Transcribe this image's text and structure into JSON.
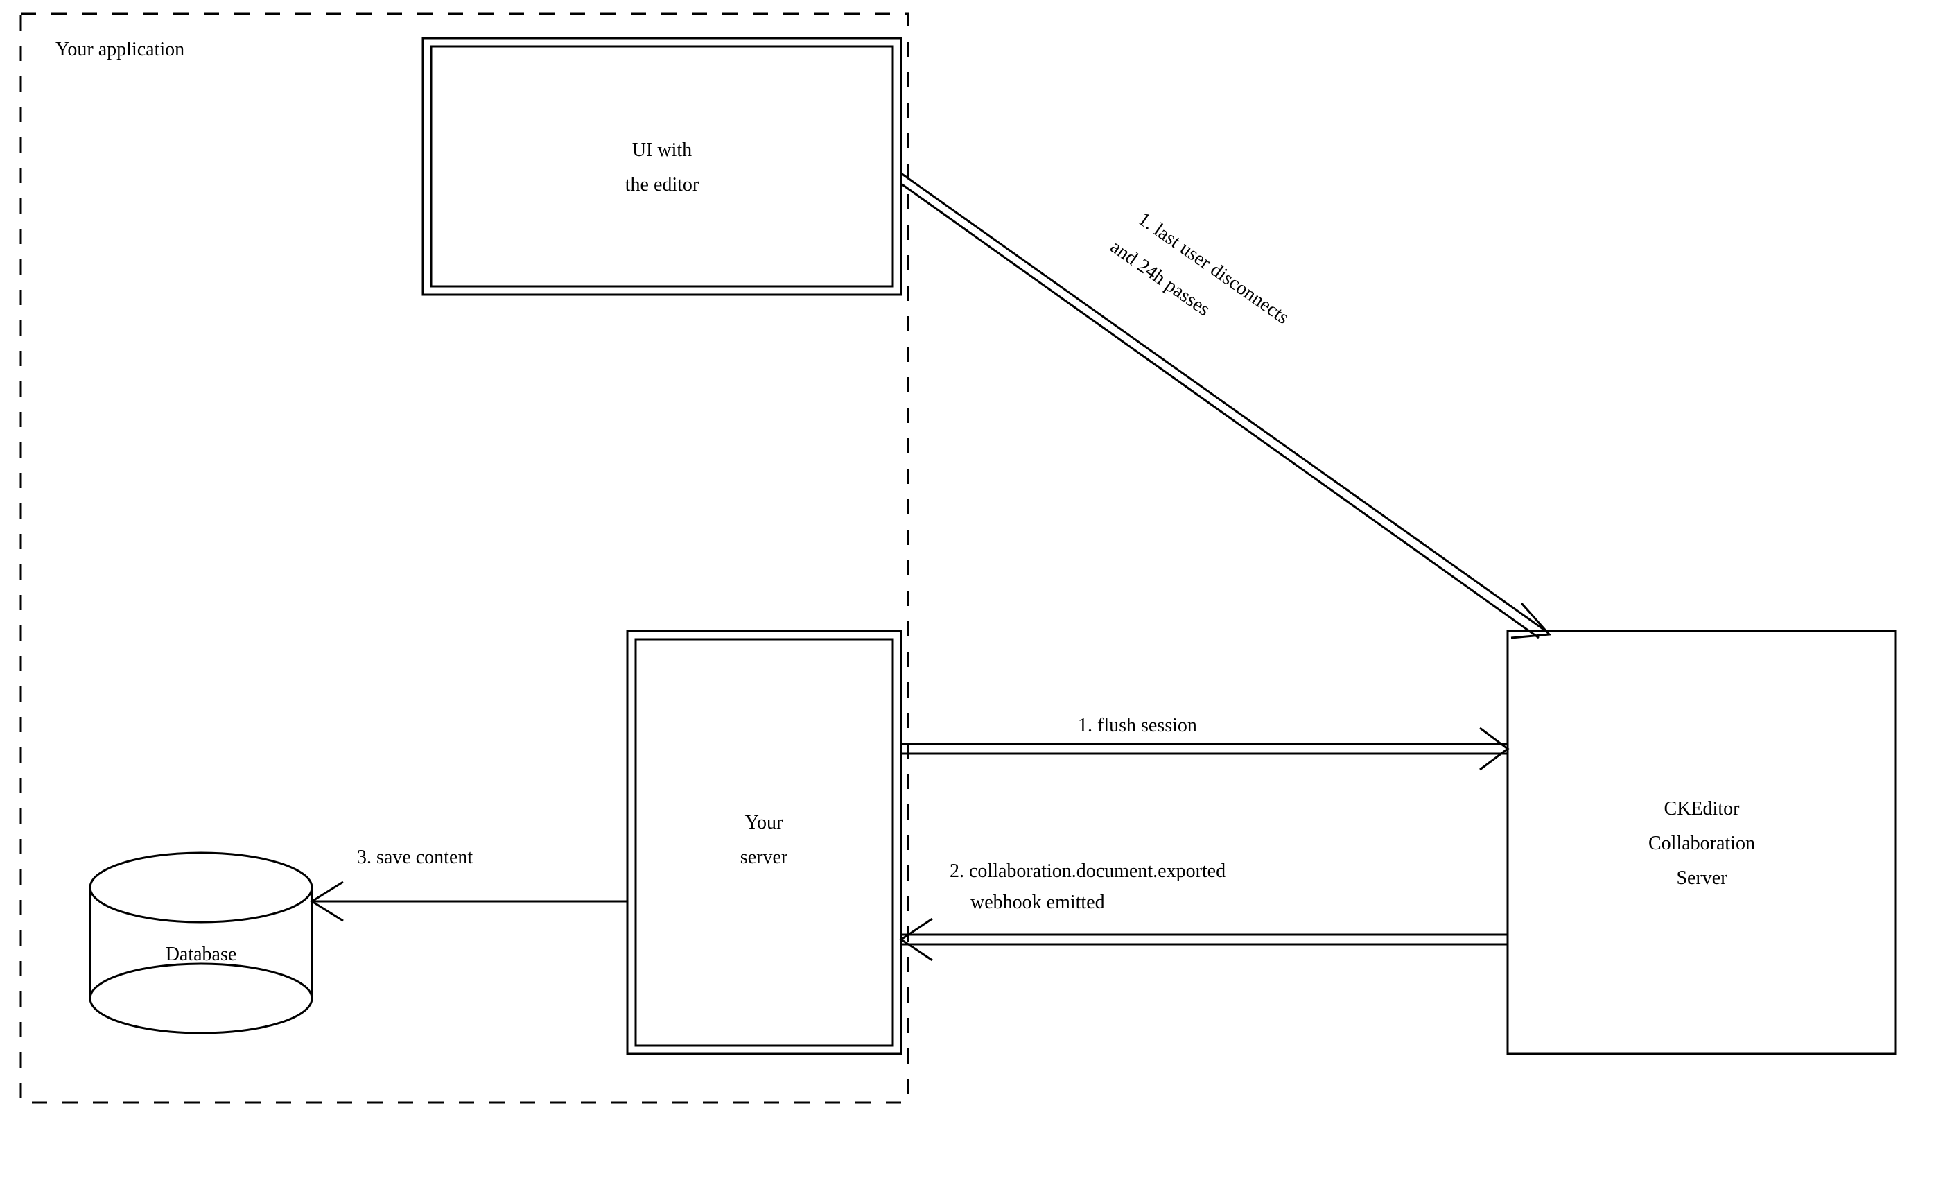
{
  "title": "Your application",
  "nodes": {
    "ui": {
      "line1": "UI with",
      "line2": "the editor"
    },
    "server": {
      "line1": "Your",
      "line2": "server"
    },
    "database": {
      "label": "Database"
    },
    "ckeditor": {
      "line1": "CKEditor",
      "line2": "Collaboration",
      "line3": "Server"
    }
  },
  "edges": {
    "disconnect": {
      "line1": "1. last user disconnects",
      "line2": "and 24h passes"
    },
    "flush": {
      "label": "1. flush session"
    },
    "webhook": {
      "line1": "2. collaboration.document.exported",
      "line2": "webhook emitted"
    },
    "save": {
      "label": "3. save content"
    }
  }
}
